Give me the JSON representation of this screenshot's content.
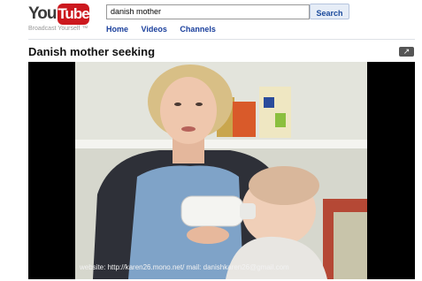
{
  "header": {
    "logo_you": "You",
    "logo_tube": "Tube",
    "tagline": "Broadcast Yourself ™",
    "search_value": "danish mother",
    "search_button": "Search",
    "nav": [
      "Home",
      "Videos",
      "Channels"
    ]
  },
  "video": {
    "title": "Danish mother seeking",
    "expand_icon": "expand-arrow-icon",
    "caption": "website: http://karen26.mono.net/  mail: danishkaren26@gmail.com"
  },
  "colors": {
    "brand_red": "#cc181e",
    "link_blue": "#1a3f9c"
  }
}
